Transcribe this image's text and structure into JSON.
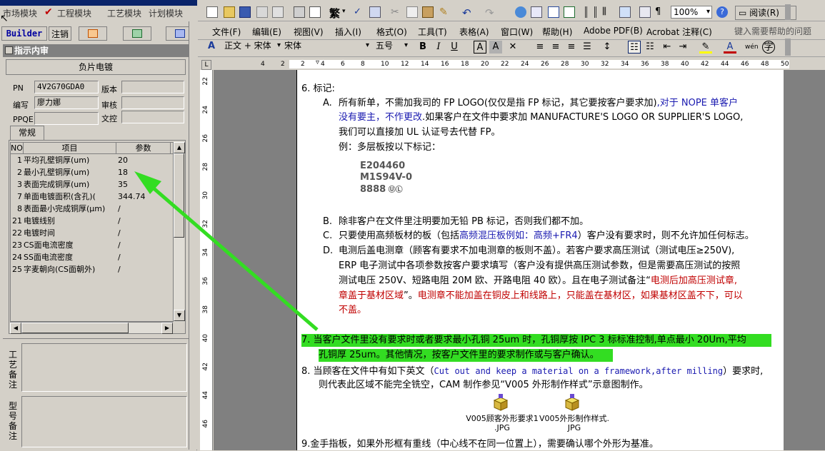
{
  "left_app": {
    "menu": [
      "市场模块",
      "工程模块",
      "工艺模块",
      "计划模块"
    ],
    "toolbar": {
      "builder": "Builder",
      "logout": "注销"
    },
    "panel_title": "指示内审",
    "panel_name": "负片电镀",
    "fields": {
      "pn_label": "PN",
      "pn_value": "4V2G70GDA0",
      "version_label": "版本",
      "version_value": "",
      "author_label": "编写",
      "author_value": "廖力娜",
      "review_label": "审核",
      "review_value": "",
      "ppqe_label": "PPQE",
      "ppqe_value": "",
      "control_label": "文控",
      "control_value": ""
    },
    "tab_label": "常规",
    "grid": {
      "headers": [
        "NO",
        "项目",
        "参数"
      ],
      "rows": [
        {
          "no": "1",
          "item": "平均孔壁铜厚(um)",
          "param": "20"
        },
        {
          "no": "2",
          "item": "最小孔壁铜厚(um)",
          "param": "18"
        },
        {
          "no": "3",
          "item": "表面完成铜厚(um)",
          "param": "35"
        },
        {
          "no": "7",
          "item": "单面电镀面积(含孔)(",
          "param": "344.74"
        },
        {
          "no": "8",
          "item": "表面最小完成铜厚(μm)",
          "param": "/"
        },
        {
          "no": "21",
          "item": "电镀线别",
          "param": "/"
        },
        {
          "no": "22",
          "item": "电镀时间",
          "param": "/"
        },
        {
          "no": "23",
          "item": "CS面电流密度",
          "param": "/"
        },
        {
          "no": "24",
          "item": "SS面电流密度",
          "param": "/"
        },
        {
          "no": "25",
          "item": "字麦朝向(CS面朝外)",
          "param": "/"
        }
      ]
    },
    "memo1_label": "工艺备注",
    "memo2_label": "型号备注"
  },
  "word": {
    "menu": [
      "文件(F)",
      "编辑(E)",
      "视图(V)",
      "插入(I)",
      "格式(O)",
      "工具(T)",
      "表格(A)",
      "窗口(W)",
      "帮助(H)",
      "Adobe PDF(B)",
      "Acrobat 注释(C)"
    ],
    "ask_placeholder": "键入需要帮助的问题",
    "zoom": "100%",
    "read_label": "阅读(R)",
    "trad_label": "繁",
    "style_combo": "正文 + 宋体",
    "font_combo": "宋体",
    "size_combo": "五号",
    "ruler_numbers": [
      "4",
      "2",
      "2",
      "4",
      "6",
      "8",
      "10",
      "12",
      "14",
      "16",
      "18",
      "20",
      "22",
      "24",
      "26",
      "28",
      "30",
      "32",
      "34",
      "36",
      "38",
      "40",
      "42",
      "44",
      "46",
      "48",
      "50"
    ],
    "vruler_numbers": [
      "22",
      "24",
      "26",
      "28",
      "30",
      "32",
      "34",
      "36",
      "38",
      "40",
      "42",
      "44",
      "46"
    ],
    "doc": {
      "item6_title": "6.  标记:",
      "a_label": "A.",
      "a_line1_black": "所有新单，不需加我司的 FP LOGO(仅仅是指 FP 标记，其它要按客户要求加)",
      "a_line1_blue": ",对于 NOPE 单客户",
      "a_line2_blue": "没有要主，不作更改",
      "a_line2_black": ".如果客户在文件中要求加 MANUFACTURE'S LOGO OR SUPPLIER'S LOGO,",
      "a_line3": "我们可以直接加 UL 认证号去代替 FP。",
      "a_line4": "例：多层板按以下标记：",
      "ul_line1": "E204460",
      "ul_line2": "M1S94V-0",
      "ul_line3": "8888",
      "b_label": "B.",
      "b_line": "除非客户在文件里注明要加无铅 PB 标记，否则我们都不加。",
      "c_label": "C.",
      "c_black1": "只要使用高频板材的板（包括",
      "c_blue": "高频混压板例如：高频+FR4",
      "c_black2": "）客户没有要求时，则不允许加任何标志。",
      "d_label": "D.",
      "d_line1": "电测后盖电测章（顾客有要求不加电测章的板则不盖）。若客户要求高压测试（测试电压≥250V),",
      "d_line2": "ERP 电子测试中各项参数按客户要求填写（客户没有提供高压测试参数，但是需要高压测试的按照",
      "d_line3_black": "测试电压 250V、短路电阻 20M 欧、开路电阻 40 欧）。且在电子测试备注“",
      "d_line3_red": "电测后加高压测试章,",
      "d_line4_red1": "章盖于基材区域",
      "d_line4_black": "”。",
      "d_line4_red2": "电测章不能加盖在铜皮上和线路上，只能盖在基材区，如果基材区盖不下，可以",
      "d_line5_red": "不盖。",
      "item7_line1": "7.  当客户文件里没有要求时或者要求最小孔铜 25um 时，孔铜厚按 IPC 3 标标准控制,单点最小 20Um,平均",
      "item7_line2": "孔铜厚 25um。其他情况，按客户文件里的要求制作或与客户确认。",
      "item8_line1a": "8.  当顾客在文件中有如下英文（",
      "item8_line1b": "Cut out and keep a material on a framework,after milling",
      "item8_line1c": "）要求时,",
      "item8_line2": "则代表此区域不能完全铣空，CAM 制作参见“V005 外形制作样式”示意图制作。",
      "attach1_line1": "V005顾客外形要求1",
      "attach1_line2": ".JPG",
      "attach2_line1": "V005外形制作样式.",
      "attach2_line2": "JPG",
      "item9": "9.金手指板，如果外形框有重线（中心线不在同一位置上），需要确认哪个外形为基准。"
    }
  },
  "colors": {
    "highlight": "#33dd22",
    "arrow": "#33dd22",
    "blue_text": "#1a1ab0",
    "red_text": "#c00000"
  }
}
